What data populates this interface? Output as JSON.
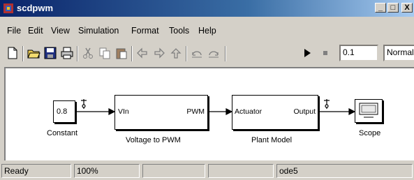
{
  "window": {
    "title": "scdpwm",
    "controls": {
      "minimize": "_",
      "maximize": "□",
      "close": "X"
    }
  },
  "menu": [
    "File",
    "Edit",
    "View",
    "Simulation",
    "Format",
    "Tools",
    "Help"
  ],
  "toolbar": {
    "icons": [
      "new-icon",
      "open-icon",
      "save-icon",
      "print-icon",
      "cut-icon",
      "copy-icon",
      "paste-icon",
      "back-icon",
      "forward-icon",
      "up-icon",
      "undo-icon",
      "redo-icon",
      "play-icon",
      "stop-icon"
    ],
    "stop_time": "0.1",
    "sim_mode": "Normal"
  },
  "diagram": {
    "constant": {
      "value": "0.8",
      "label": "Constant"
    },
    "v2pwm": {
      "in_port": "VIn",
      "out_port": "PWM",
      "label": "Voltage to PWM"
    },
    "plant": {
      "in_port": "Actuator",
      "out_port": "Output",
      "label": "Plant Model"
    },
    "scope": {
      "label": "Scope"
    }
  },
  "status": {
    "state": "Ready",
    "zoom": "100%",
    "solver": "ode5"
  }
}
